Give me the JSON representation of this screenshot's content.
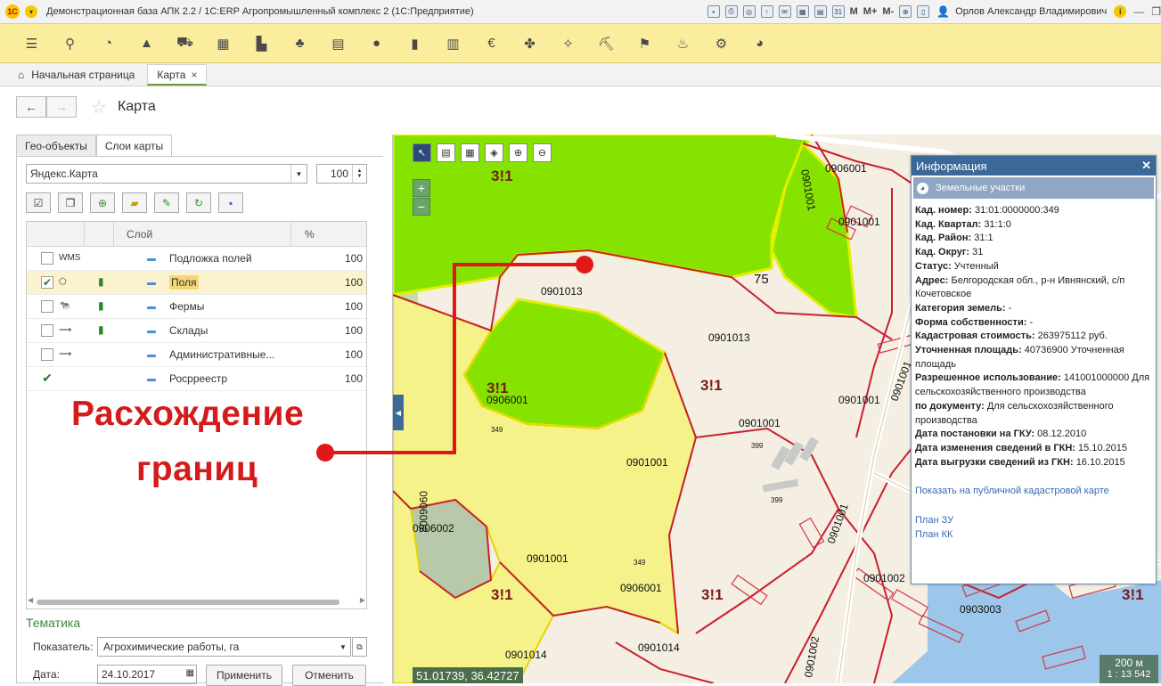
{
  "window": {
    "app_title": "Демонстрационная база АПК 2.2 / 1С:ERP Агропромышленный комплекс 2 (1С:Предприятие)",
    "logo": "1С",
    "user": "Орлов Александр Владимирович",
    "m_buttons": [
      "M",
      "M+",
      "M-"
    ]
  },
  "tabs": [
    {
      "label": "Начальная страница"
    },
    {
      "label": "Карта",
      "close": "×"
    }
  ],
  "page": {
    "title": "Карта"
  },
  "panel_tabs": [
    "Гео-объекты",
    "Слои карты"
  ],
  "layer_source": {
    "value": "Яндекс.Карта",
    "opacity": "100"
  },
  "grid": {
    "columns": {
      "layer": "Слой",
      "percent": "%"
    },
    "rows": [
      {
        "icon": "WMS",
        "checked": false,
        "name": "Подложка полей",
        "percent": "100"
      },
      {
        "icon": "⬠",
        "checked": true,
        "name": "Поля",
        "percent": "100"
      },
      {
        "icon": "🐄",
        "checked": false,
        "name": "Фермы",
        "percent": "100"
      },
      {
        "icon": "⟶",
        "checked": false,
        "name": "Склады",
        "percent": "100"
      },
      {
        "icon": "⟶",
        "checked": false,
        "name": "Административные...",
        "percent": "100"
      },
      {
        "icon": "",
        "checked": true,
        "name": "Росрреестр",
        "percent": "100"
      }
    ]
  },
  "thematic": {
    "title": "Тематика",
    "indicator_label": "Показатель:",
    "indicator_value": "Агрохимические работы, га",
    "date_label": "Дата:",
    "date_value": "24.10.2017",
    "apply": "Применить",
    "cancel": "Отменить"
  },
  "annotation": {
    "line1": "Расхождение",
    "line2": "границ",
    "color": "#d41b1b"
  },
  "map": {
    "coords": "51.01739, 36.42727",
    "scale_distance": "200 м",
    "scale_ratio": "1 : 13 542",
    "labels": {
      "l1": "3!1",
      "l2": "0906001",
      "l3": "0901001",
      "l4": "75",
      "l5": "0901013",
      "l6": "0901013",
      "l7": "3!1",
      "l8": "0906001",
      "l9": "3!1",
      "l10": "0901001",
      "l11": "0901001",
      "l12": "0901001",
      "l13": "0906002",
      "l14": "0906002",
      "l15": "0901001",
      "l16": "349",
      "l17": "349",
      "l18": "0906001",
      "l19": "3!1",
      "l20": "3!1",
      "l21": "0901014",
      "l22": "0901014",
      "l23": "0901002",
      "l24": "0901001",
      "l25": "0901002",
      "l26": "0903003",
      "l27": "3!1",
      "l28": "399",
      "l29": "399",
      "l30": "0901001",
      "l31": "0901001"
    }
  },
  "info": {
    "title": "Информация",
    "section": "Земельные участки",
    "fields": [
      {
        "k": "Кад. номер:",
        "v": "31:01:0000000:349"
      },
      {
        "k": "Кад. Квартал:",
        "v": "31:1:0"
      },
      {
        "k": "Кад. Район:",
        "v": "31:1"
      },
      {
        "k": "Кад. Округ:",
        "v": "31"
      },
      {
        "k": "Статус:",
        "v": "Учтенный"
      },
      {
        "k": "Адрес:",
        "v": "Белгородская обл., р-н Ивнянский, с/п Кочетовское"
      },
      {
        "k": "Категория земель:",
        "v": "-"
      },
      {
        "k": "Форма собственности:",
        "v": "-"
      },
      {
        "k": "Кадастровая стоимость:",
        "v": "263975112 руб."
      },
      {
        "k": "Уточненная площадь:",
        "v": "40736900 Уточненная площадь"
      },
      {
        "k": "Разрешенное использование:",
        "v": "141001000000 Для сельскохозяйственного производства"
      },
      {
        "k": "по документу:",
        "v": "Для сельскохозяйственного производства"
      },
      {
        "k": "Дата постановки на ГКУ:",
        "v": "08.12.2010"
      },
      {
        "k": "Дата изменения сведений в ГКН:",
        "v": "15.10.2015"
      },
      {
        "k": "Дата выгрузки сведений из ГКН:",
        "v": "16.10.2015"
      }
    ],
    "links": {
      "public_map": "Показать на публичной кадастровой карте",
      "plan_zu": "План ЗУ",
      "plan_kk": "План КК"
    }
  }
}
